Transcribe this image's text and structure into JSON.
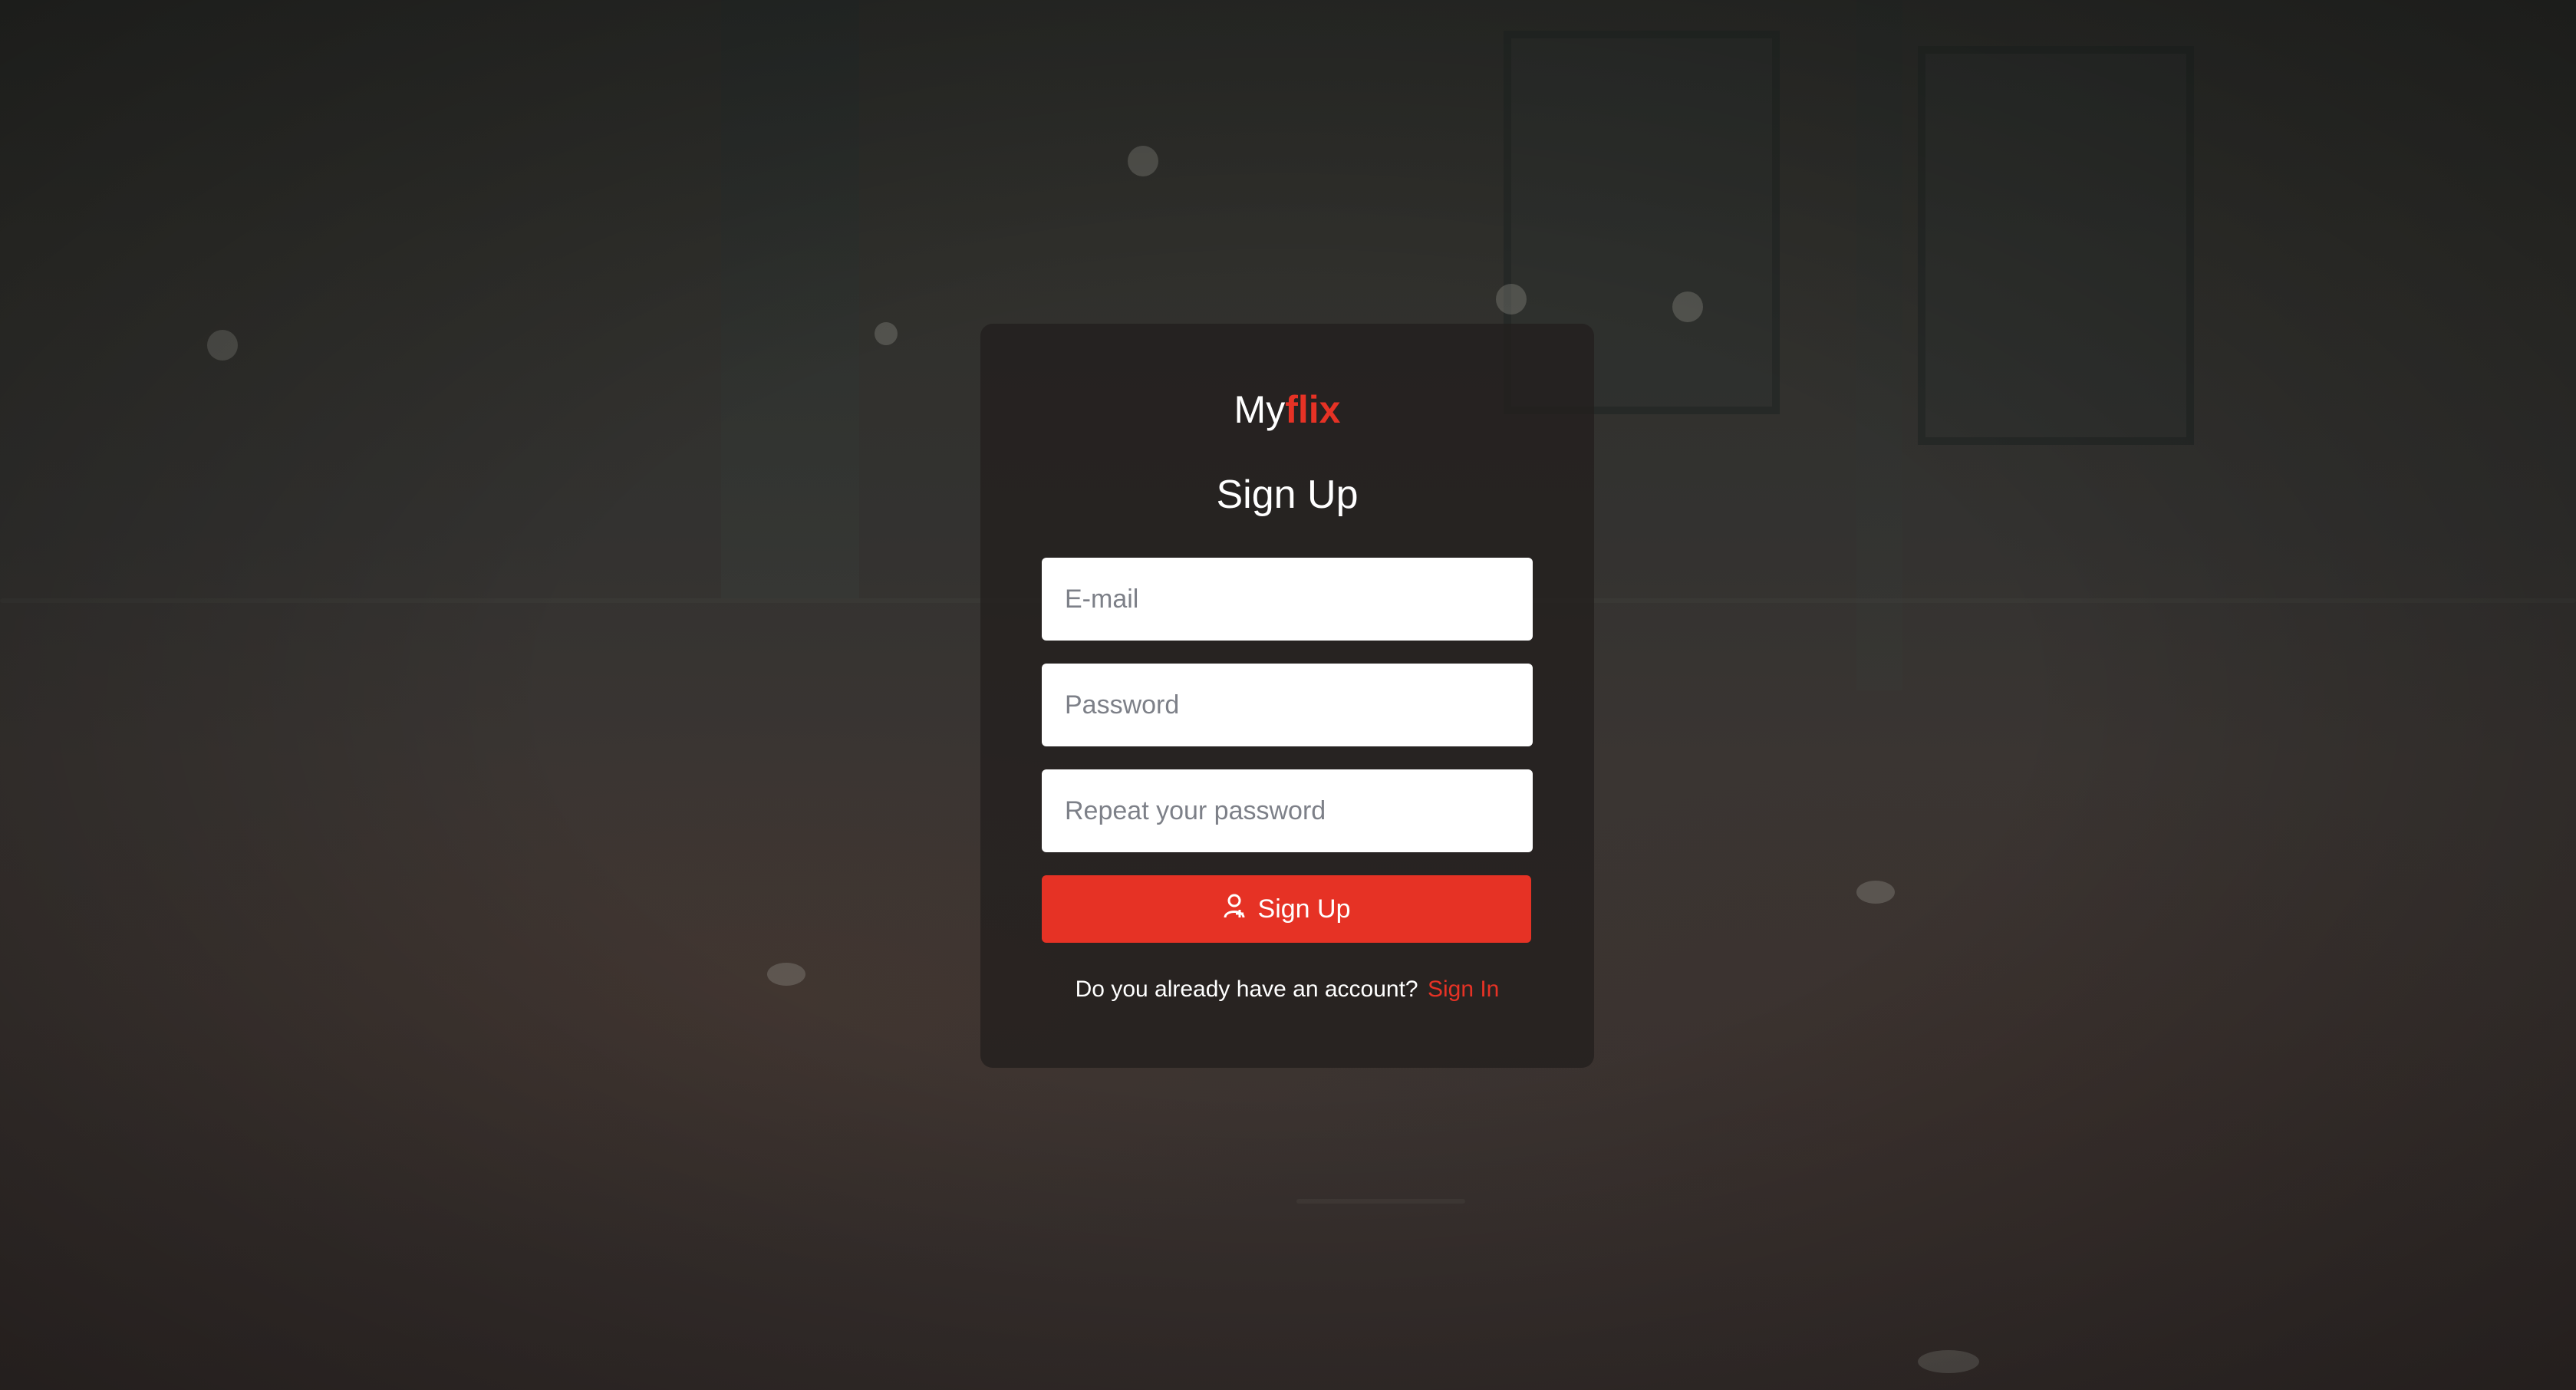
{
  "brand": {
    "prefix": "My",
    "accent": "flix",
    "accent_color": "#e63225"
  },
  "form": {
    "title": "Sign Up",
    "email_placeholder": "E-mail",
    "email_value": "",
    "password_placeholder": "Password",
    "password_value": "",
    "repeat_placeholder": "Repeat your password",
    "repeat_value": "",
    "submit_label": "Sign Up",
    "submit_icon": "user-add-icon",
    "submit_color": "#e63225"
  },
  "footer": {
    "question": "Do you already have an account?",
    "link_label": "Sign In"
  },
  "background": {
    "description_icon": "rainy-street-background"
  }
}
